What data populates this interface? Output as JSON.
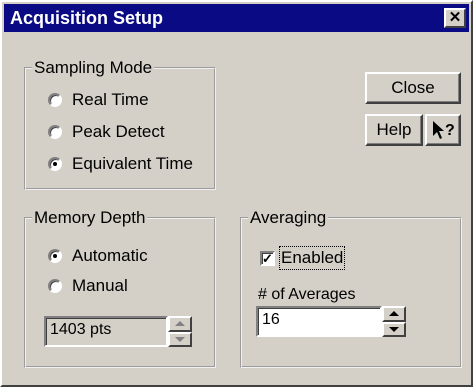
{
  "window": {
    "title": "Acquisition Setup",
    "close_glyph": "✕"
  },
  "sampling_mode": {
    "legend": "Sampling Mode",
    "options": [
      {
        "label": "Real Time",
        "selected": false
      },
      {
        "label": "Peak Detect",
        "selected": false
      },
      {
        "label": "Equivalent Time",
        "selected": true
      }
    ]
  },
  "buttons": {
    "close": "Close",
    "help": "Help",
    "whats_this_glyph": "?"
  },
  "memory_depth": {
    "legend": "Memory Depth",
    "options": [
      {
        "label": "Automatic",
        "selected": true
      },
      {
        "label": "Manual",
        "selected": false
      }
    ],
    "value": "1403 pts"
  },
  "averaging": {
    "legend": "Averaging",
    "enabled_label": "Enabled",
    "enabled": true,
    "count_label": "# of Averages",
    "count_value": "16"
  }
}
